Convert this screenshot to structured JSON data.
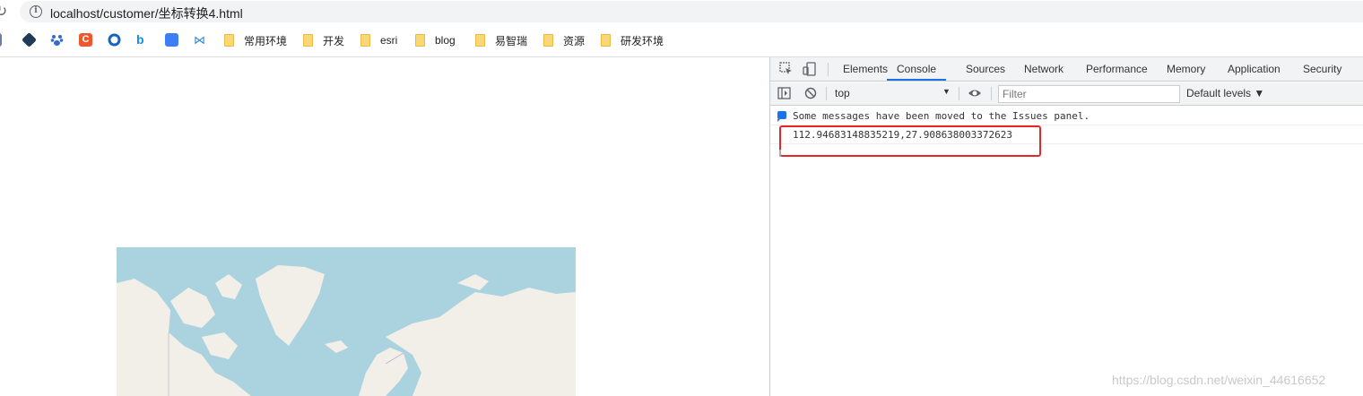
{
  "browser": {
    "url": "localhost/customer/坐标转换4.html"
  },
  "bookmarks": [
    {
      "label": "常用环境"
    },
    {
      "label": "开发"
    },
    {
      "label": "esri"
    },
    {
      "label": "blog"
    },
    {
      "label": "易智瑞"
    },
    {
      "label": "资源"
    },
    {
      "label": "研发环境"
    }
  ],
  "bookmark_icons": [
    {
      "icon": "bookmark-dark-icon",
      "color": "#1f3b57"
    },
    {
      "icon": "baidu-paw-icon",
      "color": "#2f6ad9"
    },
    {
      "icon": "csdn-c-icon",
      "color": "#f0562b"
    },
    {
      "icon": "ring-icon",
      "color": "#1565c0"
    },
    {
      "icon": "bing-icon",
      "color": "#138ef0"
    },
    {
      "icon": "edit-square-icon",
      "color": "#3d7ef5"
    },
    {
      "icon": "vscode-icon",
      "color": "#2a8ad8"
    }
  ],
  "devtools": {
    "tabs": [
      "Elements",
      "Console",
      "Sources",
      "Network",
      "Performance",
      "Memory",
      "Application",
      "Security"
    ],
    "active_tab": "Console",
    "context": "top",
    "filter_placeholder": "Filter",
    "levels": "Default levels ▼",
    "messages": [
      {
        "text": "Some messages have been moved to the Issues panel."
      },
      {
        "text": "112.94683148835219,27.908638003372623"
      }
    ]
  },
  "colors": {
    "map_water": "#aad3df",
    "map_land": "#f2efe9",
    "highlight_border": "#e52727",
    "active_tab_underline": "#1a73e8"
  },
  "watermark": "https://blog.csdn.net/weixin_44616652"
}
